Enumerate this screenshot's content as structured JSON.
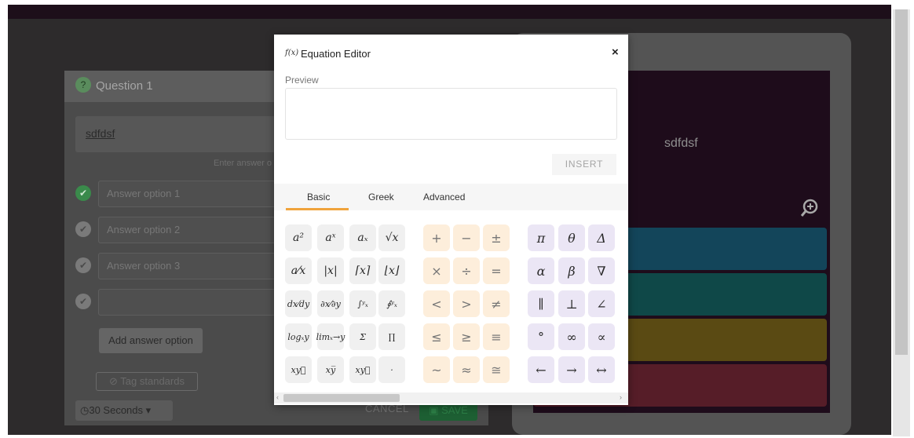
{
  "question_panel": {
    "title": "Question 1",
    "question_text": "sdfdsf",
    "enter_answer_hint": "Enter answer o",
    "options": [
      {
        "label": "Answer option 1",
        "correct": true
      },
      {
        "label": "Answer option 2",
        "correct": false
      },
      {
        "label": "Answer option 3",
        "correct": false
      },
      {
        "label": "",
        "correct": false
      }
    ],
    "add_option_label": "Add answer option",
    "tag_standards_label": "Tag standards",
    "timer_label": "30 Seconds",
    "cancel_label": "CANCEL",
    "save_label": "SAVE"
  },
  "preview_panel": {
    "question_text": "sdfdsf",
    "bar_colors": [
      "#13455a",
      "#0f4848",
      "#5a4a13",
      "#561d28"
    ]
  },
  "modal": {
    "icon_text": "f(x)",
    "title": "Equation Editor",
    "close": "×",
    "preview_label": "Preview",
    "insert_label": "INSERT",
    "tabs": [
      "Basic",
      "Greek",
      "Advanced"
    ],
    "active_tab": "Basic",
    "accent": "#f0a33c",
    "keys": [
      [
        "a²",
        "aˣ",
        "aₓ",
        "√x",
        "+",
        "−",
        "±",
        "π",
        "θ",
        "Δ"
      ],
      [
        "a⁄x",
        "|x|",
        "⌈x⌉",
        "⌊x⌋",
        "×",
        "÷",
        "=",
        "α",
        "β",
        "∇"
      ],
      [
        "dx⁄dy",
        "∂x⁄∂y",
        "∫ʸₓ",
        "∮ʸₓ",
        "<",
        ">",
        "≠",
        "∥",
        "⊥",
        "∠"
      ],
      [
        "logₓy",
        "limₓ→y",
        "Σ",
        "∏",
        "≤",
        "≥",
        "≡",
        "°",
        "∞",
        "∝"
      ],
      [
        "xy⃖",
        "xy̅",
        "xy⃗",
        "·",
        "~",
        "≈",
        "≅",
        "←",
        "→",
        "↔"
      ]
    ]
  }
}
